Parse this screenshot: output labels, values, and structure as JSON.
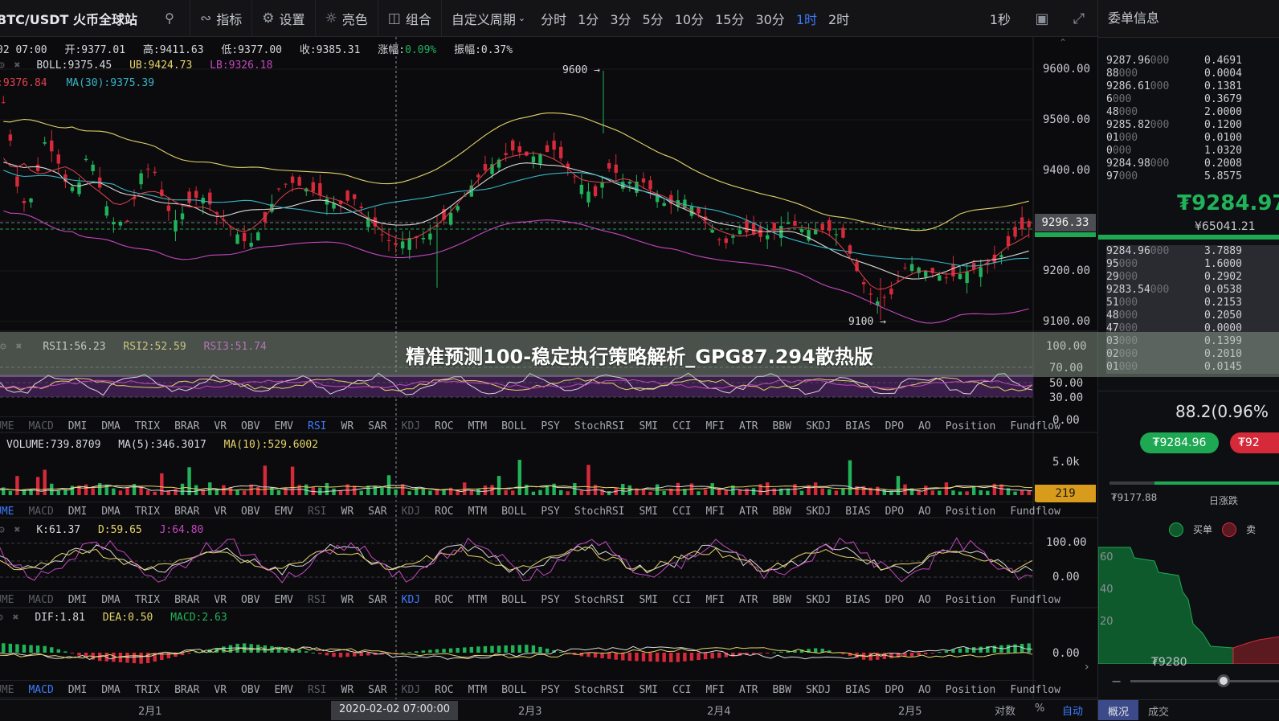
{
  "toolbar": {
    "pair_title": "BTC/USDT 火币全球站",
    "buttons": [
      {
        "icon": "indicator-icon",
        "label": "指标"
      },
      {
        "icon": "gear-icon",
        "label": "设置"
      },
      {
        "icon": "sun-icon",
        "label": "亮色"
      },
      {
        "icon": "combo-icon",
        "label": "组合"
      }
    ],
    "custom_period": "自定义周期",
    "timeframes": [
      "分时",
      "1分",
      "3分",
      "5分",
      "10分",
      "15分",
      "30分",
      "1时",
      "2时"
    ],
    "active_timeframe": "1时",
    "refresh": "1秒"
  },
  "candle_info": {
    "time": "02 07:00",
    "open": "开:9377.01",
    "high": "高:9411.63",
    "low": "低:9377.00",
    "close": "收:9385.31",
    "change_label": "涨幅:",
    "change_value": "0.09%",
    "amplitude": "振幅:0.37%"
  },
  "boll": {
    "boll": "BOLL:9375.45",
    "ub": "UB:9424.73",
    "lb": "LB:9326.18",
    "ma_partial": ":9376.84",
    "ma30": "MA(30):9375.39"
  },
  "price_axis": [
    "9600.00",
    "9500.00",
    "9400.00",
    "9200.00",
    "9100.00"
  ],
  "current_price_tag": "9296.33",
  "annotations": {
    "high": "9600",
    "low": "9100"
  },
  "rsi": {
    "rsi1": "RSI1:56.23",
    "rsi2": "RSI2:52.59",
    "rsi3": "RSI3:51.74",
    "axis": [
      "100.00",
      "70.00",
      "50.00",
      "30.00",
      "0.00"
    ]
  },
  "indicator_tabs": [
    "UME",
    "MACD",
    "DMI",
    "DMA",
    "TRIX",
    "BRAR",
    "VR",
    "OBV",
    "EMV",
    "RSI",
    "WR",
    "SAR",
    "KDJ",
    "ROC",
    "MTM",
    "BOLL",
    "PSY",
    "StochRSI",
    "SMI",
    "CCI",
    "MFI",
    "ATR",
    "BBW",
    "SKDJ",
    "BIAS",
    "DPO",
    "AO",
    "Position",
    "Fundflow"
  ],
  "volume": {
    "volume": "VOLUME:739.8709",
    "ma5": "MA(5):346.3017",
    "ma10": "MA(10):529.6002",
    "axis": "5.0k",
    "tag": "219"
  },
  "kdj": {
    "k": "K:61.37",
    "d": "D:59.65",
    "j": "J:64.80",
    "axis": [
      "100.00",
      "0.00"
    ]
  },
  "macd": {
    "dif": "DIF:1.81",
    "dea": "DEA:0.50",
    "macd": "MACD:2.63",
    "axis": "0.00"
  },
  "time_axis": [
    "2月1",
    "2020-02-02 07:00:00",
    "2月3",
    "2月4",
    "2月5"
  ],
  "bottom_bar": [
    "对数",
    "%",
    "自动"
  ],
  "orderbook": {
    "title": "委单信息",
    "asks": [
      {
        "p": "9287.96",
        "pd": "000",
        "q": "0.4691"
      },
      {
        "p": "88",
        "pd": "000",
        "q": "0.0004"
      },
      {
        "p": "9286.61",
        "pd": "000",
        "q": "0.1381"
      },
      {
        "p": "6",
        "pd": "000",
        "q": "0.3679"
      },
      {
        "p": "48",
        "pd": "000",
        "q": "2.0000"
      },
      {
        "p": "9285.82",
        "pd": "000",
        "q": "0.1200"
      },
      {
        "p": "01",
        "pd": "000",
        "q": "0.0100"
      },
      {
        "p": "0",
        "pd": "000",
        "q": "1.0320"
      },
      {
        "p": "9284.98",
        "pd": "000",
        "q": "0.2008"
      },
      {
        "p": "97",
        "pd": "000",
        "q": "5.8575"
      }
    ],
    "last_price": "₮9284.97",
    "last_cny": "¥65041.21",
    "bids": [
      {
        "p": "9284.96",
        "pd": "000",
        "q": "3.7889"
      },
      {
        "p": "95",
        "pd": "000",
        "q": "1.6000"
      },
      {
        "p": "29",
        "pd": "000",
        "q": "0.2902"
      },
      {
        "p": "9283.54",
        "pd": "000",
        "q": "0.0538"
      },
      {
        "p": "51",
        "pd": "000",
        "q": "0.2153"
      },
      {
        "p": "48",
        "pd": "000",
        "q": "0.2050"
      },
      {
        "p": "47",
        "pd": "000",
        "q": "0.0000"
      },
      {
        "p": "03",
        "pd": "000",
        "q": "0.1399"
      },
      {
        "p": "02",
        "pd": "000",
        "q": "0.2010"
      },
      {
        "p": "01",
        "pd": "000",
        "q": "0.0145"
      }
    ],
    "change": "88.2(0.96%",
    "buy_price": "₮9284.96",
    "sell_price": "₮92",
    "day_low": "₮9177.88",
    "day_label": "日涨跌",
    "day_progress": 0.26,
    "legend_buy": "买单",
    "legend_sell": "卖",
    "depth_axis": [
      "60",
      "40",
      "20"
    ],
    "depth_price": "₮9280",
    "tabs": [
      "概况",
      "成交"
    ]
  },
  "banner": "精准预测100-稳定执行策略解析_GPG87.294散热版",
  "colors": {
    "up": "#21b35a",
    "down": "#d62a3a",
    "accent": "#3d7bff",
    "boll": "#e4d36a",
    "lb": "#c347c0",
    "ma": "#36b6c6"
  }
}
